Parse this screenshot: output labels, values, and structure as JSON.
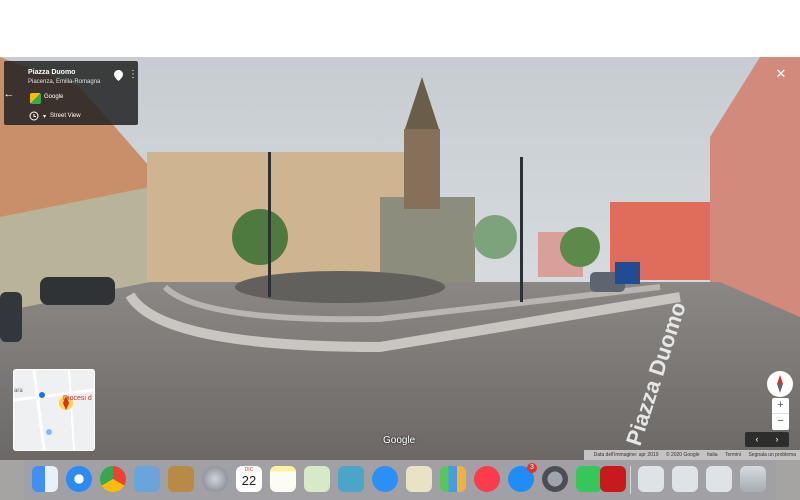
{
  "street_view": {
    "location": {
      "title": "Piazza Duomo",
      "subtitle": "Piacenza, Emilia-Romagna",
      "brand": "Google",
      "mode_label": "Street View"
    },
    "minimap": {
      "left_label": "ara",
      "label": "Diocesi d"
    },
    "watermark": "Google",
    "street_label": "Piazza Duomo",
    "footer": {
      "imagery_date": "Data dell'immagine: apr 2019",
      "copyright": "© 2020 Google",
      "country": "Italia",
      "terms": "Termini",
      "report": "Segnala un problema"
    },
    "controls": {
      "close": "✕",
      "zoom_in": "+",
      "zoom_out": "−",
      "prev": "‹",
      "next": "›"
    }
  },
  "dock": {
    "calendar_month": "DIC",
    "calendar_day": "22",
    "appstore_badge": "3",
    "items": [
      "finder",
      "safari",
      "chrome",
      "preview",
      "notefile",
      "launchpad",
      "calendar",
      "notes",
      "photos-app",
      "photos",
      "messages",
      "texts",
      "numbers",
      "music",
      "app-store",
      "system-preferences",
      "facetime",
      "acrobat",
      "screen-1",
      "screen-2",
      "screen-3",
      "trash"
    ]
  }
}
